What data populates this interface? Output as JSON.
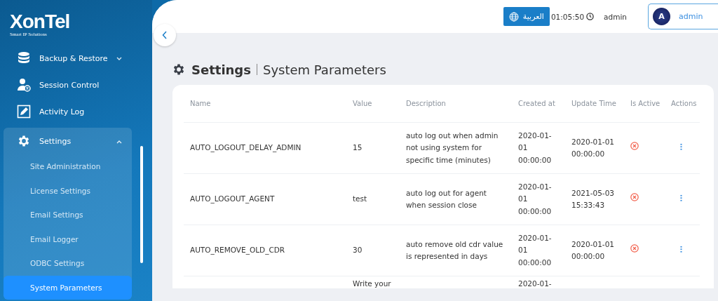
{
  "sidebar": {
    "logo": {
      "name": "XonTel",
      "tagline": "Smart IP Solutions"
    },
    "items": [
      {
        "label": "Backup & Restore",
        "expanded": false,
        "selected": false
      },
      {
        "label": "Session Control",
        "selected": false
      },
      {
        "label": "Activity Log",
        "selected": false
      },
      {
        "label": "Settings",
        "expanded": true,
        "selected": false,
        "children": [
          {
            "label": "Site Administration",
            "selected": false
          },
          {
            "label": "License Settings",
            "selected": false
          },
          {
            "label": "Email Settings",
            "selected": false
          },
          {
            "label": "Email Logger",
            "selected": false
          },
          {
            "label": "ODBC Settings",
            "selected": false
          },
          {
            "label": "System Parameters",
            "selected": true
          }
        ]
      }
    ]
  },
  "header": {
    "language_button": "العربية",
    "time": "01:05:50",
    "username": "admin",
    "user_menu": {
      "avatar": "A",
      "name": "admin"
    }
  },
  "page_title": {
    "section": "Settings",
    "page": "System Parameters"
  },
  "table": {
    "columns": [
      "Name",
      "Value",
      "Description",
      "Created at",
      "Update Time",
      "Is Active",
      "Actions"
    ],
    "rows": [
      {
        "name": "AUTO_LOGOUT_DELAY_ADMIN",
        "value": "15",
        "description": "auto log out when admin not using system for specific time (minutes)",
        "created_at": "2020-01-01 00:00:00",
        "update_time": "2020-01-01 00:00:00",
        "is_active": false
      },
      {
        "name": "AUTO_LOGOUT_AGENT",
        "value": "test",
        "description": "auto log out for agent when session close",
        "created_at": "2020-01-01 00:00:00",
        "update_time": "2021-05-03 15:33:43",
        "is_active": false
      },
      {
        "name": "AUTO_REMOVE_OLD_CDR",
        "value": "30",
        "description": "auto remove old cdr value is represented in days",
        "created_at": "2020-01-01 00:00:00",
        "update_time": "2020-01-01 00:00:00",
        "is_active": false
      },
      {
        "value": "Write your",
        "created_at": "2020-01-"
      }
    ]
  }
}
